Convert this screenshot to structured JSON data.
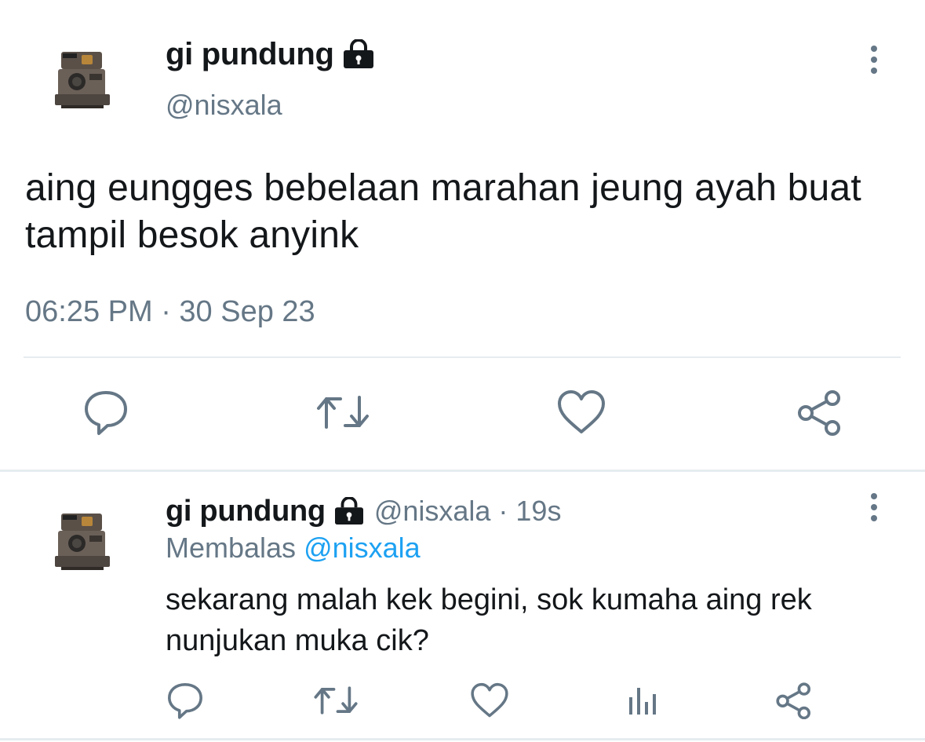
{
  "main_tweet": {
    "display_name": "gi pundung",
    "handle": "@nisxala",
    "text": "aing eungges bebelaan marahan jeung ayah buat tampil besok anyink",
    "timestamp": "06:25 PM · 30 Sep 23",
    "icons": [
      "avatar-camera",
      "lock-icon",
      "more-vertical-icon",
      "reply-icon",
      "retweet-icon",
      "like-icon",
      "share-icon"
    ]
  },
  "reply_tweet": {
    "display_name": "gi pundung",
    "meta": "@nisxala · 19s",
    "replying_prefix": "Membalas",
    "replying_to": "@nisxala",
    "text": "sekarang malah kek begini, sok kumaha aing rek nunjukan muka cik?",
    "icons": [
      "avatar-camera",
      "lock-icon",
      "more-vertical-icon",
      "reply-icon",
      "retweet-icon",
      "like-icon",
      "analytics-icon",
      "share-icon"
    ]
  },
  "colors": {
    "text": "#14171a",
    "secondary": "#657786",
    "accent": "#1da1f2",
    "divider": "#e6ecf0"
  }
}
